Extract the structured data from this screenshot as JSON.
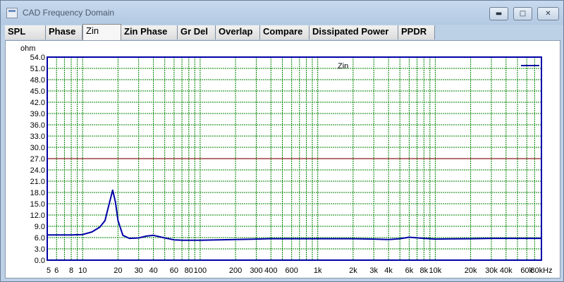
{
  "window": {
    "title": "CAD Frequency Domain",
    "buttons": {
      "minimize_icon": "minimize-icon",
      "maximize_icon": "maximize-icon",
      "close_icon": "close-icon"
    }
  },
  "tabs": [
    {
      "label": "SPL",
      "active": false
    },
    {
      "label": "Phase",
      "active": false
    },
    {
      "label": "Zin",
      "active": true
    },
    {
      "label": "Zin Phase",
      "active": false
    },
    {
      "label": "Gr Del",
      "active": false
    },
    {
      "label": "Overlap",
      "active": false
    },
    {
      "label": "Compare",
      "active": false
    },
    {
      "label": "Dissipated Power",
      "active": false
    },
    {
      "label": "PPDR",
      "active": false
    }
  ],
  "colors": {
    "grid": "#008000",
    "frame": "#0000a8",
    "curve": "#0000a8",
    "reference_line": "#8b1a1a"
  },
  "chart_data": {
    "type": "line",
    "title": "Zin",
    "ylabel": "ohm",
    "xlabel": "",
    "x_scale": "log",
    "xlim": [
      5,
      80000
    ],
    "ylim": [
      0,
      54
    ],
    "y_ticks": [
      "0.0",
      "3.0",
      "6.0",
      "9.0",
      "12.0",
      "15.0",
      "18.0",
      "21.0",
      "24.0",
      "27.0",
      "30.0",
      "33.0",
      "36.0",
      "39.0",
      "42.0",
      "45.0",
      "48.0",
      "51.0",
      "54.0"
    ],
    "x_ticks": [
      {
        "value": 5,
        "label": "5"
      },
      {
        "value": 6,
        "label": "6"
      },
      {
        "value": 8,
        "label": "8"
      },
      {
        "value": 10,
        "label": "10"
      },
      {
        "value": 20,
        "label": "20"
      },
      {
        "value": 30,
        "label": "30"
      },
      {
        "value": 40,
        "label": "40"
      },
      {
        "value": 60,
        "label": "60"
      },
      {
        "value": 80,
        "label": "80"
      },
      {
        "value": 100,
        "label": "100"
      },
      {
        "value": 200,
        "label": "200"
      },
      {
        "value": 300,
        "label": "300"
      },
      {
        "value": 400,
        "label": "400"
      },
      {
        "value": 600,
        "label": "600"
      },
      {
        "value": 1000,
        "label": "1k"
      },
      {
        "value": 2000,
        "label": "2k"
      },
      {
        "value": 3000,
        "label": "3k"
      },
      {
        "value": 4000,
        "label": "4k"
      },
      {
        "value": 6000,
        "label": "6k"
      },
      {
        "value": 8000,
        "label": "8k"
      },
      {
        "value": 10000,
        "label": "10k"
      },
      {
        "value": 20000,
        "label": "20k"
      },
      {
        "value": 30000,
        "label": "30k"
      },
      {
        "value": 40000,
        "label": "40k"
      },
      {
        "value": 60000,
        "label": "60k"
      },
      {
        "value": 80000,
        "label": "80kHz"
      }
    ],
    "grid": true,
    "legend": "top-right",
    "reference_line": 27.0,
    "series": [
      {
        "name": "Zin",
        "x": [
          5,
          8,
          10,
          12,
          14,
          15.5,
          17,
          18,
          19,
          20,
          22,
          25,
          30,
          35,
          40,
          50,
          60,
          70,
          100,
          200,
          300,
          400,
          600,
          1000,
          2000,
          3000,
          4000,
          5000,
          6000,
          8000,
          10000,
          20000,
          30000,
          40000,
          60000,
          80000
        ],
        "y": [
          6.7,
          6.7,
          6.8,
          7.5,
          8.8,
          10.5,
          15.5,
          18.6,
          15.5,
          10.5,
          6.6,
          5.8,
          5.9,
          6.4,
          6.6,
          5.9,
          5.4,
          5.3,
          5.3,
          5.5,
          5.6,
          5.7,
          5.7,
          5.7,
          5.7,
          5.6,
          5.5,
          5.7,
          6.1,
          5.8,
          5.6,
          5.7,
          5.8,
          5.8,
          5.8,
          5.8
        ]
      }
    ]
  }
}
